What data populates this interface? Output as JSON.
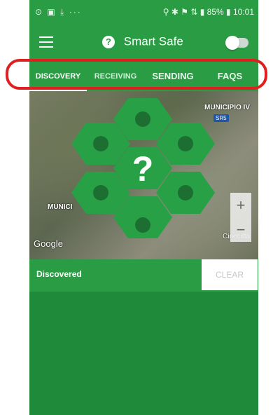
{
  "status_bar": {
    "left_icons": "⊙ ▣ ⤓ ···",
    "right_text": "⚲ ✱ ⚑ ⇅ ▮ 85% ▮ 10:01"
  },
  "app_bar": {
    "title": "Smart Safe",
    "help_badge": "?"
  },
  "tabs": [
    {
      "label": "DISCOVERY",
      "active": true
    },
    {
      "label": "RECEIVING",
      "active": false
    },
    {
      "label": "SENDING",
      "active": false
    },
    {
      "label": "FAQS",
      "active": false
    }
  ],
  "map": {
    "labels": [
      "MUNICIPIO IV",
      "SR5",
      "MUNICI",
      "Cinecittà"
    ],
    "attribution": "Google",
    "zoom_in": "+",
    "zoom_out": "−",
    "center_mark": "?"
  },
  "results": {
    "label": "Discovered",
    "clear_button": "CLEAR"
  },
  "colors": {
    "primary": "#2a9d44",
    "dark_primary": "#1f8a3a",
    "highlight": "#e02020"
  }
}
